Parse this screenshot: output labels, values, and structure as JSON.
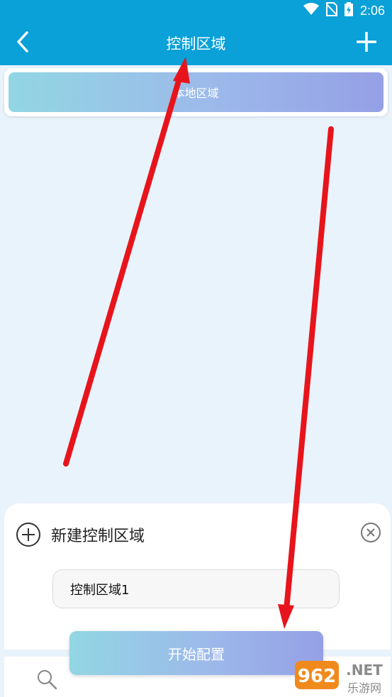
{
  "status_bar": {
    "time": "2:06",
    "icons": [
      "wifi-icon",
      "no-sim-icon",
      "battery-charging-icon"
    ]
  },
  "app_bar": {
    "title": "控制区域",
    "back_icon": "chevron-left-icon",
    "add_icon": "plus-icon"
  },
  "area_list": {
    "items": [
      {
        "label": "本地区域"
      }
    ]
  },
  "new_area_sheet": {
    "title": "新建控制区域",
    "header_icon": "plus-circle-icon",
    "close_icon": "close-circle-icon",
    "name_input_value": "控制区域1",
    "start_button_label": "开始配置",
    "search_icon": "search-icon"
  },
  "watermark": {
    "text": "962.NET",
    "subtext": "乐游网"
  },
  "colors": {
    "app_bar": "#0aa0d8",
    "background": "#e9f3fc",
    "gradient_start": "#92d6e3",
    "gradient_end": "#95a0e6",
    "annotation_arrow": "#e8141b"
  }
}
